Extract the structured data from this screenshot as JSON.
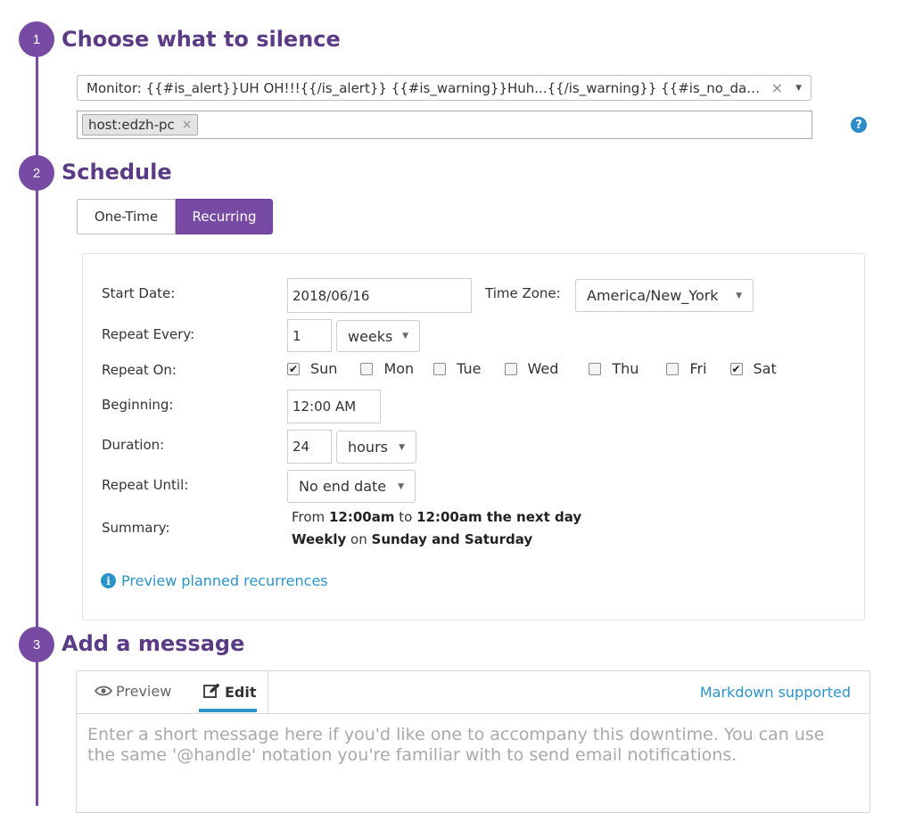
{
  "steps": [
    {
      "number": "1",
      "title": "Choose what to silence"
    },
    {
      "number": "2",
      "title": "Schedule"
    },
    {
      "number": "3",
      "title": "Add a message"
    }
  ],
  "silence": {
    "monitor_value": "Monitor: {{#is_alert}}UH OH!!!{{/is_alert}} {{#is_warning}}Huh...{{/is_warning}} {{#is_no_data}}...",
    "clear_glyph": "×",
    "tag": "host:edzh-pc",
    "tag_remove": "×",
    "help_glyph": "?"
  },
  "schedule": {
    "tabs": [
      "One-Time",
      "Recurring"
    ],
    "active_tab": "Recurring",
    "labels": {
      "start_date": "Start Date:",
      "time_zone": "Time Zone:",
      "repeat_every": "Repeat Every:",
      "repeat_on": "Repeat On:",
      "beginning": "Beginning:",
      "duration": "Duration:",
      "repeat_until": "Repeat Until:",
      "summary": "Summary:"
    },
    "start_date": "2018/06/16",
    "time_zone": "America/New_York",
    "repeat_every_value": "1",
    "repeat_every_unit": "weeks",
    "days": [
      {
        "label": "Sun",
        "checked": true
      },
      {
        "label": "Mon",
        "checked": false
      },
      {
        "label": "Tue",
        "checked": false
      },
      {
        "label": "Wed",
        "checked": false
      },
      {
        "label": "Thu",
        "checked": false
      },
      {
        "label": "Fri",
        "checked": false
      },
      {
        "label": "Sat",
        "checked": true
      }
    ],
    "beginning": "12:00 AM",
    "duration_value": "24",
    "duration_unit": "hours",
    "repeat_until": "No end date",
    "summary": {
      "line1_prefix": "From",
      "line1_start": "12:00am",
      "line1_mid": "to",
      "line1_end": "12:00am the next day",
      "line2_freq": "Weekly",
      "line2_mid": "on",
      "line2_days": "Sunday and Saturday"
    },
    "preview_link": "Preview planned recurrences"
  },
  "message": {
    "tab_preview": "Preview",
    "tab_edit": "Edit",
    "markdown_link": "Markdown supported",
    "placeholder": "Enter a short message here if you'd like one to accompany this downtime. You can use the same '@handle' notation you're familiar with to send email notifications."
  },
  "colors": {
    "accent": "#774aa4",
    "heading": "#5b3a86",
    "link": "#2a93c9"
  }
}
